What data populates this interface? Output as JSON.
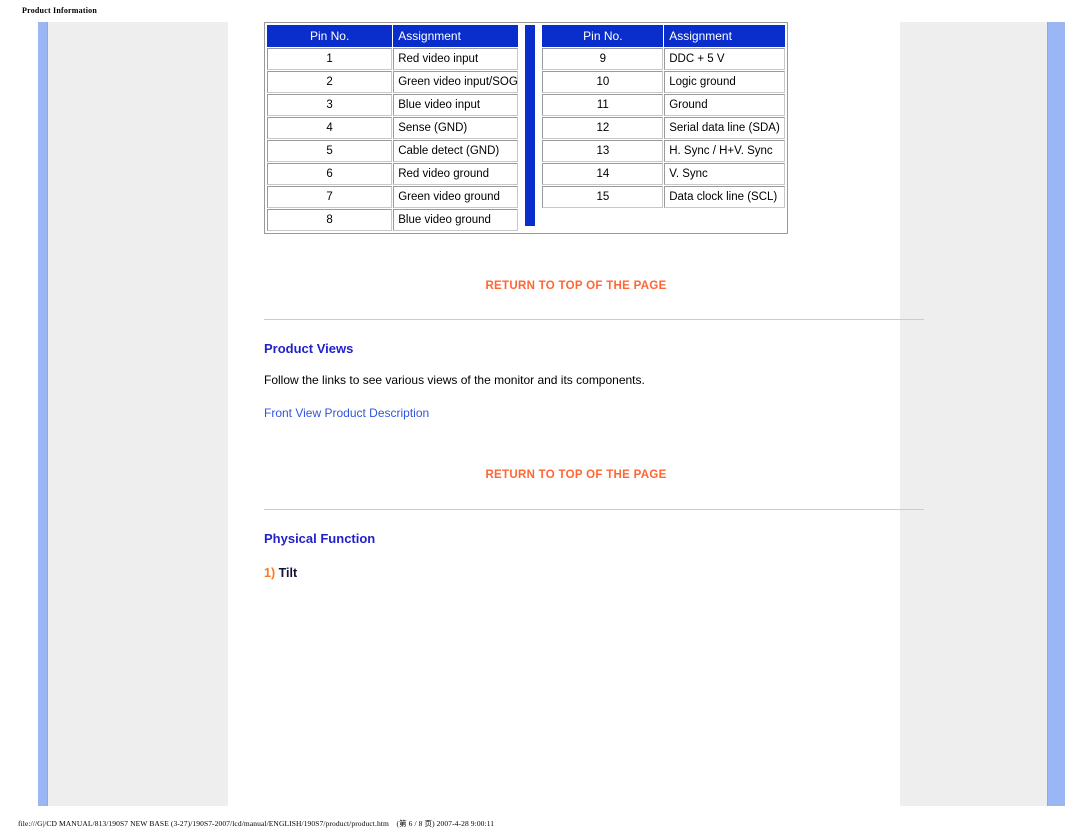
{
  "document": {
    "header_title": "Product Information",
    "footer_path": "file:///G|/CD MANUAL/813/190S7 NEW BASE (3-27)/190S7-2007/lcd/manual/ENGLISH/190S7/product/product.htm　(第 6 / 8 页) 2007-4-28 9:00:11"
  },
  "pin_tables": {
    "headers": {
      "pin": "Pin No.",
      "assignment": "Assignment"
    },
    "left_rows": [
      {
        "pin": "1",
        "assignment": "Red video input"
      },
      {
        "pin": "2",
        "assignment": "Green video input/SOG"
      },
      {
        "pin": "3",
        "assignment": "Blue video input"
      },
      {
        "pin": "4",
        "assignment": "Sense (GND)"
      },
      {
        "pin": "5",
        "assignment": "Cable detect (GND)"
      },
      {
        "pin": "6",
        "assignment": "Red video ground"
      },
      {
        "pin": "7",
        "assignment": "Green video ground"
      },
      {
        "pin": "8",
        "assignment": "Blue video ground"
      }
    ],
    "right_rows": [
      {
        "pin": "9",
        "assignment": "DDC + 5 V"
      },
      {
        "pin": "10",
        "assignment": "Logic ground"
      },
      {
        "pin": "11",
        "assignment": "Ground"
      },
      {
        "pin": "12",
        "assignment": "Serial data line (SDA)"
      },
      {
        "pin": "13",
        "assignment": "H. Sync / H+V. Sync"
      },
      {
        "pin": "14",
        "assignment": "V. Sync"
      },
      {
        "pin": "15",
        "assignment": "Data clock line (SCL)"
      }
    ]
  },
  "sections": {
    "return_top_1": "RETURN TO TOP OF THE PAGE",
    "product_views_heading": "Product Views",
    "product_views_text": "Follow the links to see various views of the monitor and its components.",
    "product_views_link": "Front View Product Description",
    "return_top_2": "RETURN TO TOP OF THE PAGE",
    "physical_function_heading": "Physical Function",
    "tilt_number": "1)",
    "tilt_label": "Tilt"
  },
  "colors": {
    "table_header_blue": "#0a2ecc",
    "link_orange": "#ff6633",
    "heading_blue": "#2222cc",
    "inline_link_blue": "#3355dd",
    "accent_bar_blue": "#9ab6f5",
    "panel_grey": "#eeeeee"
  }
}
